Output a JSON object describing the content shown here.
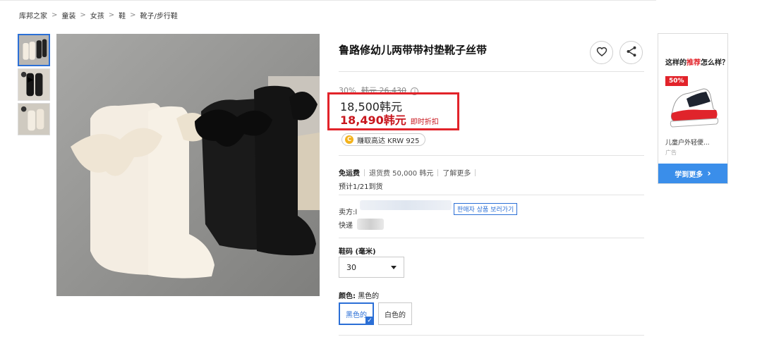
{
  "breadcrumb": [
    "库邦之家",
    "童装",
    "女孩",
    "鞋",
    "靴子/步行鞋"
  ],
  "breadcrumb_sep": ">",
  "product": {
    "title": "鲁路修幼儿两带带衬垫靴子丝带",
    "discount_pct": "30%",
    "original_price": "韩元 26,430",
    "info_icon": "i",
    "price": "18,500韩元",
    "sale_price": "18,490韩元",
    "sale_tag": "即时折扣",
    "reward_coin": "C",
    "reward_text": "赚取高达 KRW 925"
  },
  "shipping": {
    "free_label": "免运费",
    "return_fee": "退货费 50,000 韩元",
    "learn_more": "了解更多",
    "eta": "预计1/21到货"
  },
  "seller": {
    "seller_label": "卖方:",
    "seller_tail": "l",
    "store_button": "판매자 상품 보러가기",
    "express_label": "快递"
  },
  "options": {
    "size_label": "鞋码 (毫米)",
    "size_value": "30",
    "color_label_prefix": "颜色:",
    "color_label_value": "黑色的",
    "colors": [
      "黑色的",
      "白色的"
    ],
    "selected_check": "✓"
  },
  "recommendation": {
    "title_prefix": "这样的",
    "title_highlight": "推荐",
    "title_suffix": "怎么样？",
    "badge": "50%",
    "product_name": "儿童户外轻便...",
    "ad_label": "广告",
    "more_button": "学到更多",
    "more_arrow": "›"
  },
  "icons": {
    "wishlist": "heart-icon",
    "share": "share-icon"
  },
  "colors": {
    "accent_blue": "#2b6fd6",
    "sale_red": "#c8161d",
    "highlight_box": "#e2232a",
    "rec_button": "#3a8eea"
  }
}
